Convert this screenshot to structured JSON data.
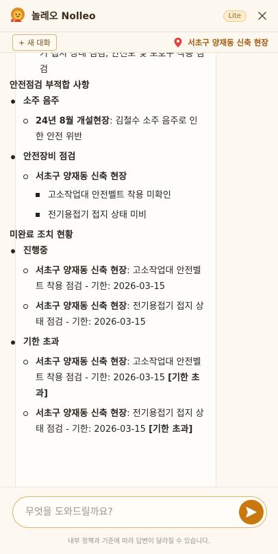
{
  "header": {
    "title": "놀레오 Nolleo",
    "badge": "Lite"
  },
  "toolbar": {
    "new_chat_label": "+ 새 대화",
    "location": "서초구 양재동 신축 현장"
  },
  "message": {
    "partial_top": "기 접지 상태 점검, 안전모 및 보호구 착용 점검",
    "section1": {
      "title": "안전점검 부적합 사항",
      "items": [
        {
          "label": "소주 음주",
          "children": [
            {
              "bold": "24년 8월 개설현장",
              "text": ": 김철수 소주 음주로 인한 안전 위반"
            }
          ]
        },
        {
          "label": "안전장비 점검",
          "children": [
            {
              "bold": "서초구 양재동 신축 현장",
              "text": "",
              "sub": [
                "고소작업대 안전벨트 착용 미확인",
                "전기용접기 접지 상태 미비"
              ]
            }
          ]
        }
      ]
    },
    "section2": {
      "title": "미완료 조치 현황",
      "items": [
        {
          "label": "진행중",
          "children": [
            {
              "bold": "서초구 양재동 신축 현장",
              "text": ": 고소작업대 안전벨트 착용 점검 - 기한: 2026-03-15"
            },
            {
              "bold": "서초구 양재동 신축 현장",
              "text": ": 전기용접기 접지 상태 점검 - 기한: 2026-03-15"
            }
          ]
        },
        {
          "label": "기한 초과",
          "children": [
            {
              "bold": "서초구 양재동 신축 현장",
              "text": ": 고소작업대 안전벨트 착용 점검 - 기한: 2026-03-15 ",
              "tag": "[기한 초과]"
            },
            {
              "bold": "서초구 양재동 신축 현장",
              "text": ": 전기용접기 접지 상태 점검 - 기한: 2026-03-15 ",
              "tag": "[기한 초과]"
            }
          ]
        }
      ]
    }
  },
  "composer": {
    "placeholder": "무엇을 도와드릴까요?",
    "disclaimer": "내부 정책과 기준에 따라 답변이 달라질 수 있습니다."
  },
  "colors": {
    "accent": "#c9780f",
    "location": "#a05a0c",
    "border": "#e0b66c"
  },
  "icons": {
    "logo": "lion-logo-icon",
    "close": "close-icon",
    "pin": "location-pin-icon",
    "send": "send-icon"
  }
}
